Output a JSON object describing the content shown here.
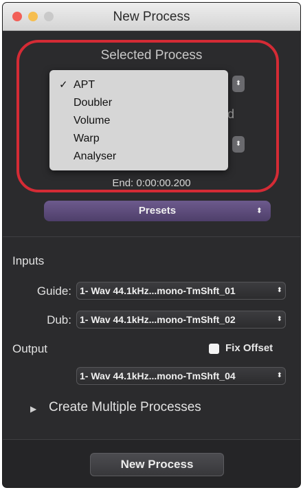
{
  "window": {
    "title": "New Process",
    "traffic_colors": {
      "close": "#f25f57",
      "minimize": "#f6be4f",
      "zoom": "#c9c9c9"
    }
  },
  "selected_process": {
    "heading": "Selected Process",
    "dropdown": {
      "items": [
        {
          "label": "APT",
          "checked": true
        },
        {
          "label": "Doubler",
          "checked": false
        },
        {
          "label": "Volume",
          "checked": false
        },
        {
          "label": "Warp",
          "checked": false
        },
        {
          "label": "Analyser",
          "checked": false
        }
      ],
      "check_mark": "✓"
    },
    "end_time": "End: 0:00:00.200",
    "highlight_color": "#d42b35"
  },
  "presets": {
    "label": "Presets",
    "color": "#5e4c7c"
  },
  "inputs": {
    "heading": "Inputs",
    "guide": {
      "label": "Guide:",
      "value": "1- Wav 44.1kHz...mono-TmShft_01"
    },
    "dub": {
      "label": "Dub:",
      "value": "1- Wav 44.1kHz...mono-TmShft_02"
    }
  },
  "output": {
    "heading": "Output",
    "fix_offset": {
      "label": "Fix Offset",
      "checked": false
    },
    "value": "1- Wav 44.1kHz...mono-TmShft_04"
  },
  "create_multiple": {
    "label": "Create Multiple Processes",
    "expanded": false
  },
  "footer": {
    "new_process_label": "New Process"
  },
  "icons": {
    "popup_arrows": "⬍",
    "disclosure": "▶"
  }
}
